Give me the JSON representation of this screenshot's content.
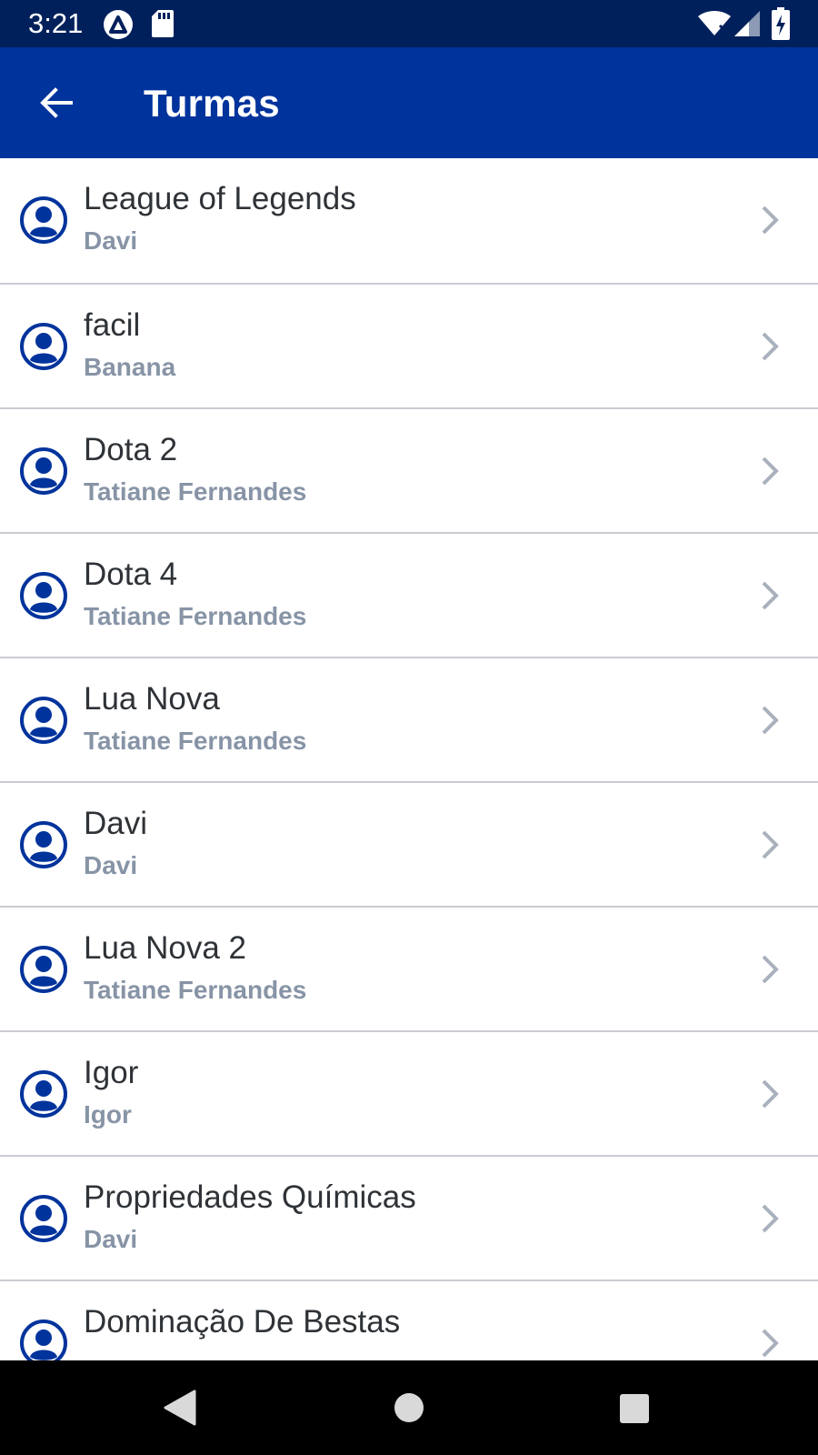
{
  "status_bar": {
    "time": "3:21",
    "icons": [
      "a-icon",
      "sd-card-icon",
      "wifi-icon",
      "signal-icon",
      "battery-charging-icon"
    ]
  },
  "app_bar": {
    "title": "Turmas",
    "back_icon": "arrow-left-icon",
    "color": "#00339c"
  },
  "list": {
    "items": [
      {
        "title": "League of Legends",
        "subtitle": "Davi"
      },
      {
        "title": "facil",
        "subtitle": "Banana"
      },
      {
        "title": "Dota 2",
        "subtitle": "Tatiane Fernandes"
      },
      {
        "title": "Dota 4",
        "subtitle": "Tatiane Fernandes"
      },
      {
        "title": "Lua Nova",
        "subtitle": "Tatiane Fernandes"
      },
      {
        "title": "Davi",
        "subtitle": "Davi"
      },
      {
        "title": "Lua Nova 2",
        "subtitle": "Tatiane Fernandes"
      },
      {
        "title": "Igor",
        "subtitle": "Igor"
      },
      {
        "title": "Propriedades Químicas",
        "subtitle": "Davi"
      },
      {
        "title": "Dominação De Bestas",
        "subtitle": ""
      }
    ],
    "avatar_icon": "user-circle-icon",
    "chevron_icon": "chevron-right-icon"
  },
  "nav_bar": {
    "icons": [
      "back-triangle-icon",
      "home-circle-icon",
      "recents-square-icon"
    ]
  },
  "colors": {
    "status_bar": "#00205c",
    "app_bar": "#00339c",
    "avatar": "#00339c",
    "title_text": "#2f3337",
    "subtitle_text": "#8794a6",
    "chevron": "#a9b1bd",
    "divider": "#c9ccd1"
  }
}
